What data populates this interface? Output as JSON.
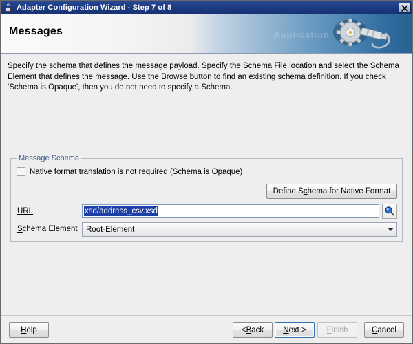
{
  "window": {
    "title": "Adapter Configuration Wizard - Step 7 of 8",
    "title_icon": "java-coffee-cup-icon",
    "close_icon": "close-icon",
    "titlebar_color": "#1d3b82",
    "background_color": "#eeeeee"
  },
  "banner": {
    "title": "Messages",
    "art_icon": "gear-and-wrench-icon",
    "ghost_text": "Application",
    "accent_color": "#28628f"
  },
  "description": "Specify the schema that defines the message payload.  Specify the Schema File location and select the Schema Element that defines the message. Use the Browse button to find an existing schema definition. If you check 'Schema is Opaque', then you do not need to specify a Schema.",
  "message_schema": {
    "legend": "Message Schema",
    "legend_color": "#3a5a8c",
    "opaque_checkbox": {
      "label_pre": "Native ",
      "label_mnemonic": "f",
      "label_post": "ormat translation is not required (Schema is Opaque)",
      "checked": false
    },
    "define_button": {
      "label_pre": "Define S",
      "label_mnemonic": "c",
      "label_post": "hema for Native Format"
    },
    "url": {
      "label_mnemonic": "URL",
      "label": "URL",
      "value": "xsd/address_csv.xsd",
      "placeholder": "",
      "selected": true,
      "selection_color": "#1c3fa8",
      "browse_icon": "magnifying-glass-icon"
    },
    "schema_element": {
      "label_mnemonic": "S",
      "label_post": "chema Element",
      "value": "Root-Element",
      "options": [
        "Root-Element"
      ],
      "arrow_icon": "chevron-down-icon"
    }
  },
  "footer": {
    "help": {
      "pre": "",
      "mnemonic": "H",
      "post": "elp"
    },
    "back": {
      "pre": "< ",
      "mnemonic": "B",
      "post": "ack"
    },
    "next": {
      "pre": "",
      "mnemonic": "N",
      "post": "ext >",
      "focused": true
    },
    "finish": {
      "pre": "",
      "mnemonic": "F",
      "post": "inish",
      "enabled": false
    },
    "cancel": {
      "pre": "",
      "mnemonic": "C",
      "post": "ancel"
    }
  }
}
